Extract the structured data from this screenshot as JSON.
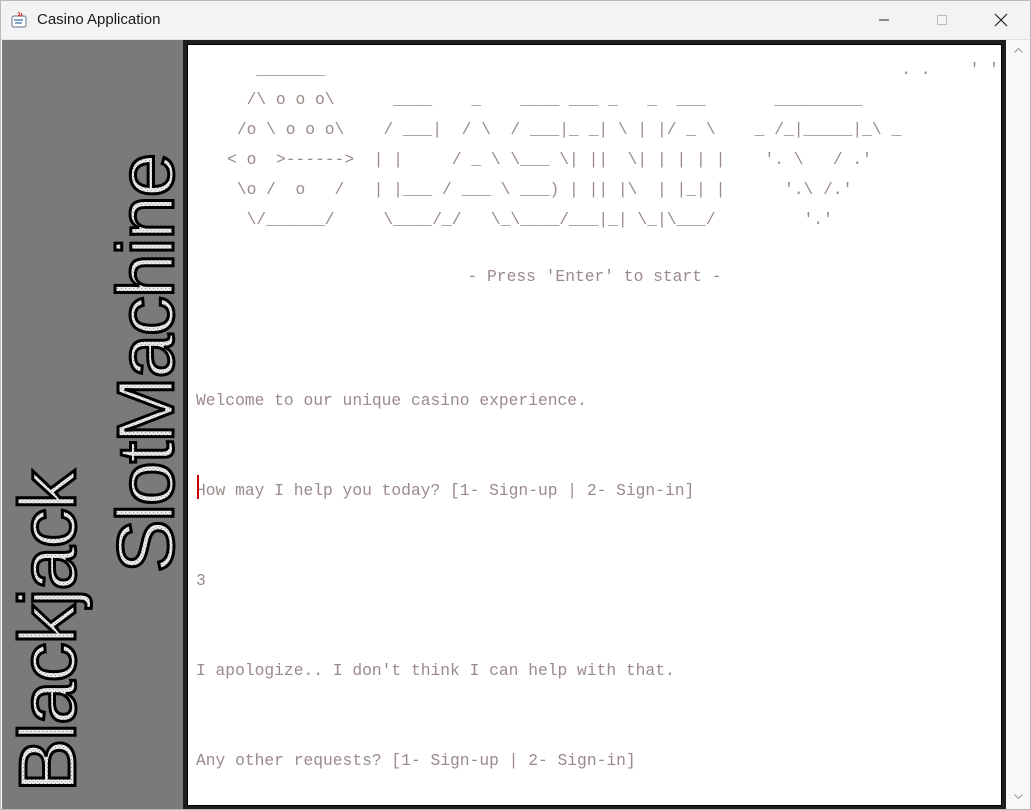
{
  "window": {
    "title": "Casino Application",
    "controls": {
      "minimize": "minimize-icon",
      "maximize": "maximize-icon",
      "close": "close-icon"
    }
  },
  "sidebar": {
    "label1": "SlotMachine",
    "label2": "Blackjack"
  },
  "banner": {
    "ascii": "       _______                                                           . .    ' '  ,  ,\n      /\\ o o o\\      ____    _    ____ ___ _   _  ___       _________\n     /o \\ o o o\\    / ___|  / \\  / ___|_ _| \\ | |/ _ \\    _ /_|_____|_\\ _\n    < o  >------>  | |     / _ \\ \\___ \\| ||  \\| | | | |    '. \\   / .'\n     \\o /  o   /   | |___ / ___ \\ ___) | || |\\  | |_| |      '.\\ /.'\n      \\/______/     \\____/_/   \\_\\____/___|_| \\_|\\___/         '.'",
    "start_prompt": "- Press 'Enter' to start -"
  },
  "console": {
    "lines": [
      "Welcome to our unique casino experience.",
      "How may I help you today? [1- Sign-up | 2- Sign-in]",
      "3",
      "I apologize.. I don't think I can help with that.",
      "Any other requests? [1- Sign-up | 2- Sign-in]"
    ]
  },
  "colors": {
    "text": "#9b8a8a",
    "caret": "#c00000",
    "sidebar": "#7a7a7a"
  }
}
